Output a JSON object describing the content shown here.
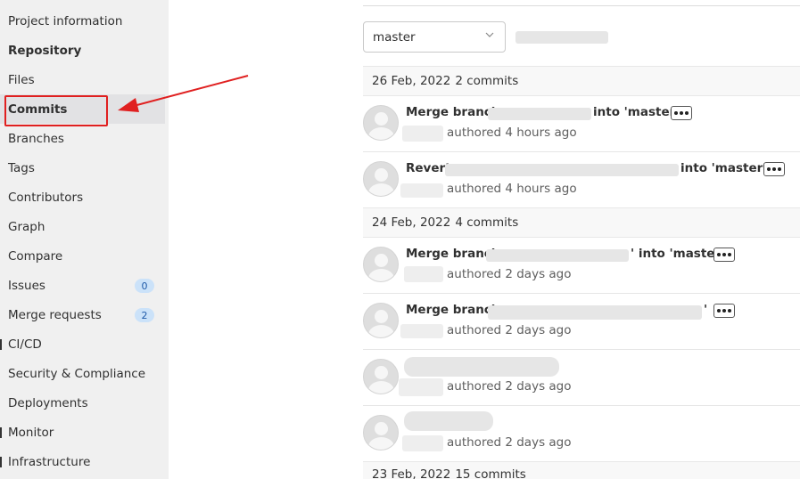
{
  "sidebar": {
    "items": [
      {
        "label": "Project information"
      },
      {
        "label": "Repository"
      },
      {
        "label": "Files"
      },
      {
        "label": "Commits"
      },
      {
        "label": "Branches"
      },
      {
        "label": "Tags"
      },
      {
        "label": "Contributors"
      },
      {
        "label": "Graph"
      },
      {
        "label": "Compare"
      },
      {
        "label": "Issues",
        "badge": "0"
      },
      {
        "label": "Merge requests",
        "badge": "2"
      },
      {
        "label": "CI/CD"
      },
      {
        "label": "Security & Compliance"
      },
      {
        "label": "Deployments"
      },
      {
        "label": "Monitor"
      },
      {
        "label": "Infrastructure"
      }
    ]
  },
  "branch_selector": {
    "value": "master"
  },
  "groups": [
    {
      "date": "26 Feb, 2022",
      "count": "2 commits"
    },
    {
      "date": "24 Feb, 2022",
      "count": "4 commits"
    },
    {
      "date": "23 Feb, 2022",
      "count": "15 commits"
    }
  ],
  "commits": [
    {
      "title_start": "Merge branch",
      "title_end": "into 'master'",
      "meta": "authored 4 hours ago"
    },
    {
      "title_start": "Revert",
      "title_end": "into 'master'\"",
      "meta": "authored 4 hours ago"
    },
    {
      "title_start": "Merge branch",
      "title_end": "' into 'master'",
      "meta": "authored 2 days ago"
    },
    {
      "title_start": "Merge branch",
      "title_end": "'",
      "meta": "authored 2 days ago"
    },
    {
      "title_start": "",
      "title_end": "",
      "meta": "authored 2 days ago"
    },
    {
      "title_start": "",
      "title_end": "",
      "meta": "authored 2 days ago"
    }
  ],
  "colors": {
    "annotation": "#e02020",
    "badge_bg": "#cbe2f9",
    "badge_text": "#1f5aa8",
    "sidebar_bg": "#f0f0f0"
  }
}
